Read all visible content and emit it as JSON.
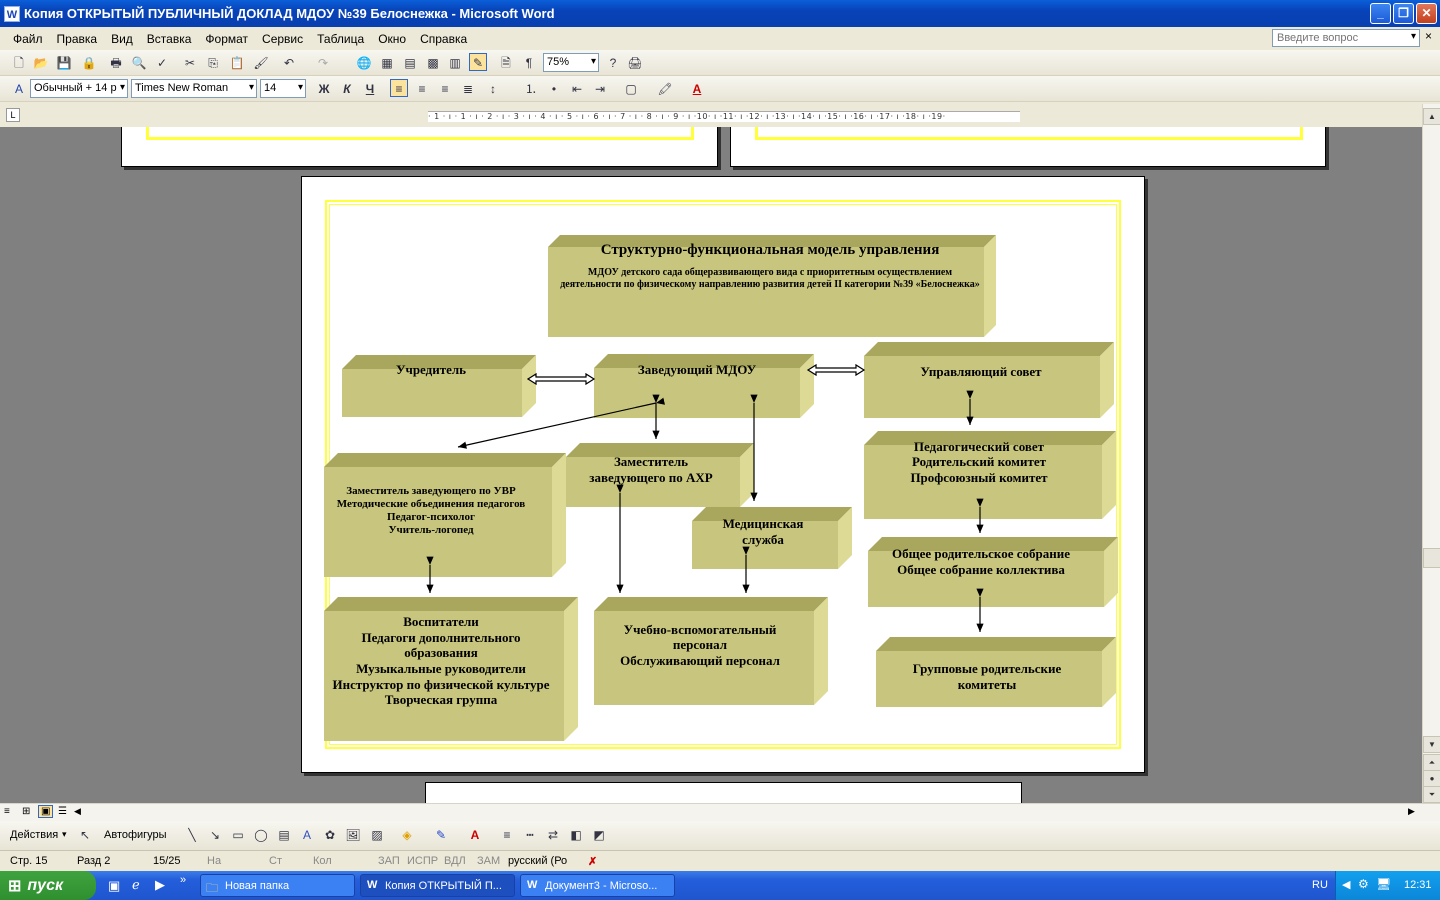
{
  "window": {
    "title": "Копия ОТКРЫТЫЙ ПУБЛИЧНЫЙ ДОКЛАД МДОУ №39 Белоснежка - Microsoft Word",
    "app_icon": "W"
  },
  "menu": [
    "Файл",
    "Правка",
    "Вид",
    "Вставка",
    "Формат",
    "Сервис",
    "Таблица",
    "Окно",
    "Справка"
  ],
  "help": {
    "placeholder": "Введите вопрос"
  },
  "toolbar": {
    "zoom": "75%"
  },
  "formatting": {
    "style": "Обычный + 14 р",
    "font": "Times New Roman",
    "size": "14",
    "bold": "Ж",
    "italic": "К",
    "underline": "Ч"
  },
  "ruler": {
    "marks": "· 1 · ı · 1 · ı · 2 · ı · 3 · ı · 4 · ı · 5 · ı · 6 · ı · 7 · ı · 8 · ı · 9 · ı ·10· ı ·11· ı ·12· ı ·13· ı ·14· ı ·15· ı ·16· ı ·17· ı ·18· ı ·19·"
  },
  "diagram": {
    "title_main": "Структурно-функциональная модель управления",
    "title_sub": "МДОУ детского сада общеразвивающего вида с приоритетным осуществлением деятельности по физическому направлению развития детей  II категории №39 «Белоснежка»",
    "founder": "Учредитель",
    "head": "Заведующий МДОУ",
    "council": "Управляющий совет",
    "deputy_uvr": [
      "Заместитель заведующего по УВР",
      "Методические объединения педагогов",
      "Педагог-психолог",
      "Учитель-логопед"
    ],
    "deputy_ahr": [
      "Заместитель",
      "заведующего по АХР"
    ],
    "medical": [
      "Медицинская",
      "служба"
    ],
    "pedsovet": [
      "Педагогический совет",
      "Родительский комитет",
      "Профсоюзный комитет"
    ],
    "meetings": [
      "Общее родительское собрание",
      "Общее собрание коллектива"
    ],
    "group_committees": [
      "Групповые родительские",
      "комитеты"
    ],
    "educators": [
      "Воспитатели",
      "Педагоги дополнительного образования",
      "Музыкальные руководители",
      "Инструктор по физической культуре",
      "Творческая группа"
    ],
    "support_staff": [
      "Учебно-вспомогательный",
      "персонал",
      "Обслуживающий персонал"
    ]
  },
  "drawing": {
    "actions": "Действия",
    "autoshapes": "Автофигуры"
  },
  "status": {
    "page": "Стр.  15",
    "section": "Разд  2",
    "pages": "15/25",
    "at": "На",
    "line": "Ст",
    "col": "Кол",
    "rec": "ЗАП",
    "trk": "ИСПР",
    "ext": "ВДЛ",
    "ovr": "ЗАМ",
    "lang": "русский (Ро"
  },
  "taskbar": {
    "start": "пуск",
    "tasks": [
      "Новая папка",
      "Копия ОТКРЫТЫЙ П...",
      "Документ3 - Microso..."
    ],
    "lang": "RU",
    "clock": "12:31"
  },
  "colors": {
    "box_face": "#c8c67e",
    "box_top": "#a9a75d",
    "box_side": "#dcda95",
    "frame": "#ffff3a"
  }
}
